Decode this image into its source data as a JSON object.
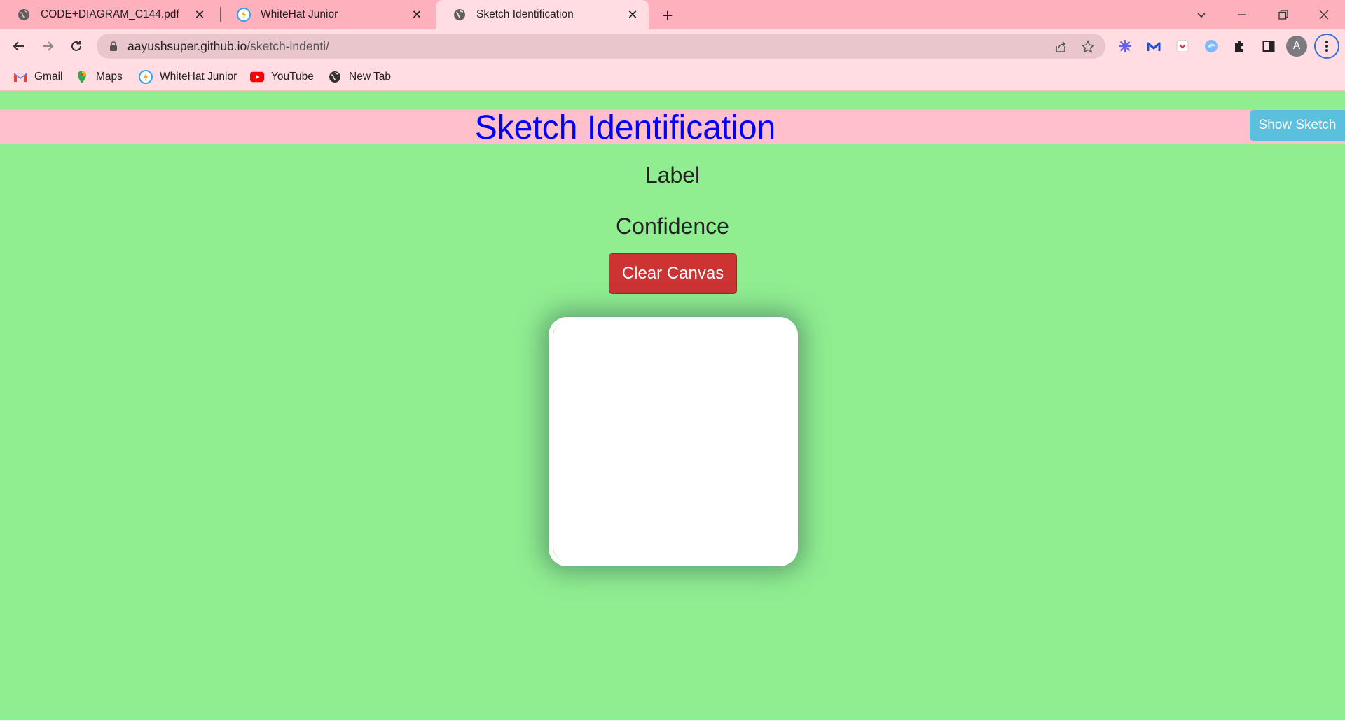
{
  "browser": {
    "tabs": [
      {
        "title": "CODE+DIAGRAM_C144.pdf",
        "icon": "globe-icon",
        "active": false
      },
      {
        "title": "WhiteHat Junior",
        "icon": "whitehat-icon",
        "active": false
      },
      {
        "title": "Sketch Identification",
        "icon": "globe-icon",
        "active": true
      }
    ],
    "url_host": "aayushsuper.github.io",
    "url_path": "/sketch-indenti/",
    "bookmarks": [
      {
        "label": "Gmail",
        "icon": "gmail-icon"
      },
      {
        "label": "Maps",
        "icon": "maps-icon"
      },
      {
        "label": "WhiteHat Junior",
        "icon": "whitehat-icon"
      },
      {
        "label": "YouTube",
        "icon": "youtube-icon"
      },
      {
        "label": "New Tab",
        "icon": "globe-icon"
      }
    ],
    "profile_initial": "A",
    "colors": {
      "tabstrip": "#ffb0bd",
      "toolbar": "#ffdde3"
    }
  },
  "page": {
    "heading": "Sketch Identification",
    "show_sketch_label": "Show Sketch",
    "label_text": "Label",
    "confidence_text": "Confidence",
    "clear_canvas_label": "Clear Canvas",
    "colors": {
      "background": "#90ee90",
      "header": "#ffc0cb",
      "heading": "#0000ff",
      "show_sketch": "#5bc0de",
      "clear_button": "#cc3333"
    }
  }
}
